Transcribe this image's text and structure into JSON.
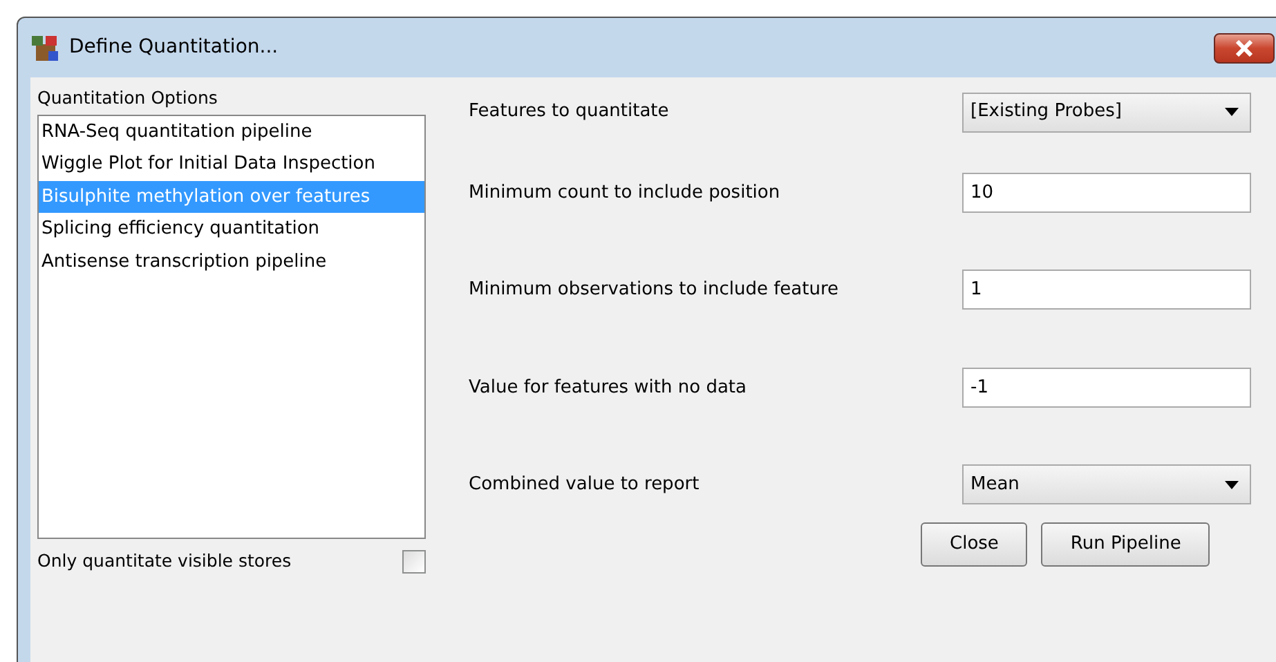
{
  "window": {
    "title": "Define Quantitation..."
  },
  "options": {
    "label": "Quantitation Options",
    "items": [
      {
        "label": "RNA-Seq quantitation pipeline",
        "selected": false
      },
      {
        "label": "Wiggle Plot for Initial Data Inspection",
        "selected": false
      },
      {
        "label": "Bisulphite methylation over features",
        "selected": true
      },
      {
        "label": "Splicing efficiency quantitation",
        "selected": false
      },
      {
        "label": "Antisense transcription pipeline",
        "selected": false
      }
    ]
  },
  "visible_stores": {
    "label": "Only quantitate visible stores",
    "checked": false
  },
  "settings": [
    {
      "label": "Features to quantitate",
      "kind": "select",
      "value": "[Existing Probes]"
    },
    {
      "label": "Minimum count to include position",
      "kind": "text",
      "value": "10"
    },
    {
      "label": "Minimum observations to include feature",
      "kind": "text",
      "value": "1"
    },
    {
      "label": "Value for features with no data",
      "kind": "text",
      "value": "-1"
    },
    {
      "label": "Combined value to report",
      "kind": "select",
      "value": "Mean"
    }
  ],
  "buttons": [
    "Close",
    "Run Pipeline"
  ]
}
